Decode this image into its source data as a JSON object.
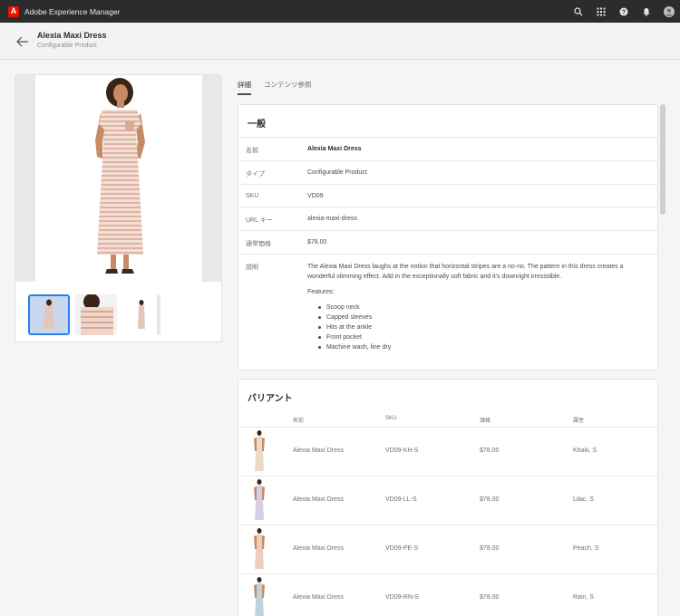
{
  "shell": {
    "app_name": "Adobe Experience Manager",
    "logo_letter": "A",
    "icons": [
      "search-icon",
      "apps-icon",
      "help-icon",
      "bell-icon",
      "user-avatar"
    ]
  },
  "header": {
    "title": "Alexia Maxi Dress",
    "subtitle": "Configurable Product"
  },
  "tabs": [
    {
      "label": "詳細",
      "active": true
    },
    {
      "label": "コンテンツ参照",
      "active": false
    }
  ],
  "general": {
    "heading": "一般",
    "fields": [
      {
        "label": "名前",
        "value": "Alexia Maxi Dress"
      },
      {
        "label": "タイプ",
        "value": "Configurable Product"
      },
      {
        "label": "SKU",
        "value": "VD09"
      },
      {
        "label": "URL キー",
        "value": "alexia-maxi-dress"
      },
      {
        "label": "通常価格",
        "value": "$78.00"
      }
    ],
    "description_label": "説明",
    "description": "The Alexia Maxi Dress laughs at the notion that horizontal stripes are a no-no. The pattern in this dress creates a wonderful slimming effect. Add in the exceptionally soft fabric and it's downright irresistible.",
    "features_label": "Features:",
    "features": [
      "Scoop neck",
      "Capped sleeves",
      "Hits at the ankle",
      "Front pocket",
      "Machine wash, line dry"
    ]
  },
  "variants": {
    "heading": "バリアント",
    "columns": [
      "名前",
      "SKU",
      "価格",
      "属性"
    ],
    "rows": [
      {
        "name": "Alexia Maxi Dress",
        "sku": "VD09-KH-S",
        "price": "$78.00",
        "attributes": "Khaki, S",
        "color": "#e8dcc4"
      },
      {
        "name": "Alexia Maxi Dress",
        "sku": "VD09-LL-S",
        "price": "$78.00",
        "attributes": "Lilac, S",
        "color": "#d6cde0"
      },
      {
        "name": "Alexia Maxi Dress",
        "sku": "VD09-PE-S",
        "price": "$78.00",
        "attributes": "Peach, S",
        "color": "#edcdbb"
      },
      {
        "name": "Alexia Maxi Dress",
        "sku": "VD09-RN-S",
        "price": "$78.00",
        "attributes": "Rain, S",
        "color": "#bfd3dc"
      }
    ]
  },
  "colors": {
    "shell_bg": "#2c2c2c",
    "accent": "#2680eb",
    "dress_stripe": "#e9c9bc"
  }
}
